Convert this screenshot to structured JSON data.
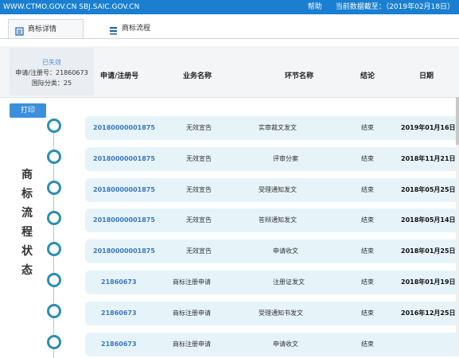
{
  "topbar": {
    "sites": "WWW.CTMO.GOV.CN SBJ.SAIC.GOV.CN",
    "help": "帮助",
    "data_date": "当前数据截至：（2019年02月18日）"
  },
  "tabs": [
    {
      "label": "商标详情",
      "icon": "document-icon"
    },
    {
      "label": "商标流程",
      "icon": "list-icon"
    }
  ],
  "status": {
    "state": "已失效",
    "reg_no": "申请/注册号：21860673",
    "intl_class": "国际分类：25"
  },
  "columns": [
    "申请/注册号",
    "业务名称",
    "环节名称",
    "结论",
    "日期"
  ],
  "print_label": "打印",
  "side_title": [
    "商",
    "标",
    "流",
    "程",
    "状",
    "态"
  ],
  "rows": [
    {
      "no": "20180000001875",
      "business": "无效宣告",
      "step": "实审裁文发文",
      "result": "结束",
      "date": "2019年01月16日"
    },
    {
      "no": "20180000001875",
      "business": "无效宣告",
      "step": "评审分案",
      "result": "结束",
      "date": "2018年11月21日"
    },
    {
      "no": "20180000001875",
      "business": "无效宣告",
      "step": "受理通知发文",
      "result": "结束",
      "date": "2018年05月25日"
    },
    {
      "no": "20180000001875",
      "business": "无效宣告",
      "step": "答辩通知发文",
      "result": "结束",
      "date": "2018年05月14日"
    },
    {
      "no": "20180000001875",
      "business": "无效宣告",
      "step": "申请收文",
      "result": "结束",
      "date": "2018年01月25日"
    },
    {
      "no": "21860673",
      "business": "商标注册申请",
      "step": "注册证发文",
      "result": "结束",
      "date": "2018年01月19日"
    },
    {
      "no": "21860673",
      "business": "商标注册申请",
      "step": "受理通知书发文",
      "result": "结束",
      "date": "2016年12月25日"
    },
    {
      "no": "21860673",
      "business": "商标注册申请",
      "step": "申请收文",
      "result": "结束",
      "date": ""
    }
  ]
}
